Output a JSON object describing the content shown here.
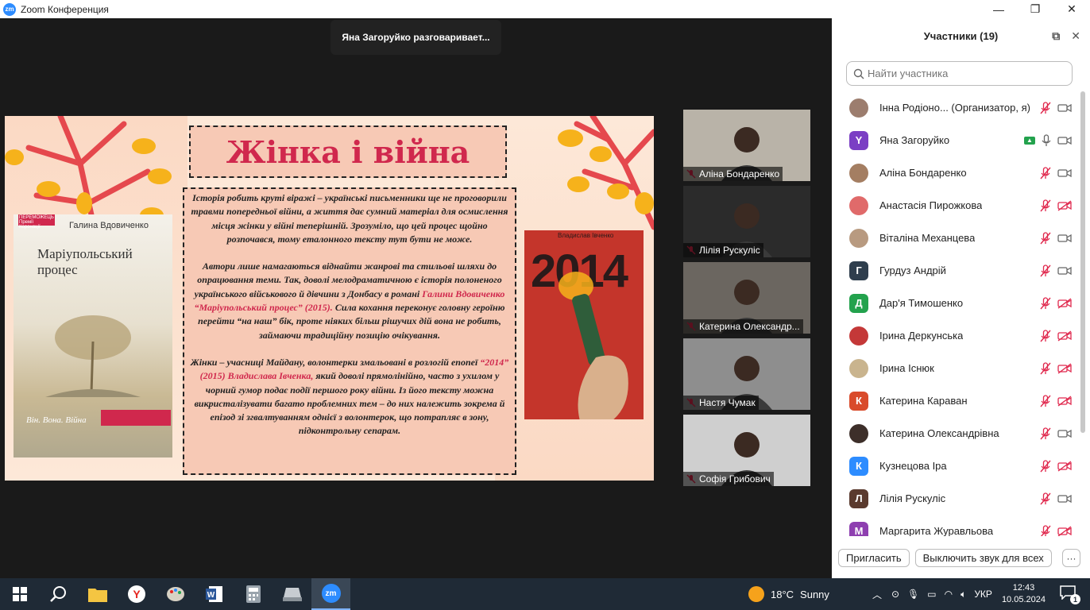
{
  "window": {
    "title": "Zoom Конференция"
  },
  "speaker_banner": "Яна Загоруйко разговариваeт...",
  "slide": {
    "title": "Жінка і війна",
    "para1": "Історія робить круті віражі – українські письменники ще не проговорили травми попередньої війни, а життя дає сумний матеріал для осмислення місця жінки у війні теперішній. Зрозуміло, що цей процес щойно розпочався, тому еталонного тексту тут бути не може.",
    "para2_a": "Автори лише намагаються віднайти жанрові та стильові шляхи до опрацювання теми. Так, доволі мелодраматичною є історія полоненого українського військового й дівчини з Донбасу в романі ",
    "para2_hl": "Галини Вдовиченко “Маріупольський процес” (2015).",
    "para2_b": " Сила кохання переконує головну героїню перейти “на наш” бік, проте ніяких більш рішучих дій вона не робить, займаючи традиційну позицію очікування.",
    "para3_a": "Жінки – учасниці Майдану, волонтерки змальовані в розлогій епопеї ",
    "para3_hl": "“2014” (2015) Владислава Івченка,",
    "para3_b": " який доволі прямолінійно, часто з ухилом у чорний гумор подає події першого року війни. Із його тексту можна викристалізувати багато проблемних тем – до них  належить зокрема й епізод зі згвалтуванням однієї з волонтерок, що потрапляє в зону, підконтрольну сепарам.",
    "book1": {
      "badge": "ПЕРЕМОЖЕЦЬ Премії Коронації",
      "author": "Галина Вдовиченко",
      "title_line1": "Маріупольський",
      "title_line2": "процес",
      "tagline": "Він. Вона. Війна"
    },
    "book2": {
      "author": "Владислав Івченко",
      "title": "2014"
    }
  },
  "video_tiles": [
    {
      "name": "Аліна Бондаренко",
      "bg": "#b9b3a8"
    },
    {
      "name": "Лілія Рускуліс",
      "bg": "#2b2b2b"
    },
    {
      "name": "Катерина Олександр...",
      "bg": "#6b6660"
    },
    {
      "name": "Настя Чумак",
      "bg": "#8e8e8e"
    },
    {
      "name": "Софія Грибович",
      "bg": "#cfcfcf"
    }
  ],
  "panel": {
    "title": "Участники (19)",
    "search_placeholder": "Найти участника",
    "participants": [
      {
        "name": "Інна Родіоно... (Организатор, я)",
        "avatar_letter": "",
        "avatar_color": "#9c7d6e",
        "video_off": false,
        "sharing": false
      },
      {
        "name": "Яна Загоруйко",
        "avatar_letter": "Y",
        "avatar_color": "#7b3fc4",
        "video_off": false,
        "sharing": true
      },
      {
        "name": "Аліна Бондаренко",
        "avatar_letter": "",
        "avatar_color": "#a47e62",
        "video_off": false,
        "sharing": false
      },
      {
        "name": "Анастасія Пирожкова",
        "avatar_letter": "",
        "avatar_color": "#e06a6a",
        "video_off": true,
        "sharing": false
      },
      {
        "name": "Віталіна Механцева",
        "avatar_letter": "",
        "avatar_color": "#b89a80",
        "video_off": false,
        "sharing": false
      },
      {
        "name": "Гурдуз Андрій",
        "avatar_letter": "Г",
        "avatar_color": "#2f3e4d",
        "video_off": false,
        "sharing": false
      },
      {
        "name": "Дар'я Тимошенко",
        "avatar_letter": "Д",
        "avatar_color": "#23a24d",
        "video_off": true,
        "sharing": false
      },
      {
        "name": "Ірина Деркунська",
        "avatar_letter": "",
        "avatar_color": "#c43838",
        "video_off": true,
        "sharing": false
      },
      {
        "name": "Ірина Існюк",
        "avatar_letter": "",
        "avatar_color": "#c9b48e",
        "video_off": true,
        "sharing": false
      },
      {
        "name": "Катерина Караван",
        "avatar_letter": "К",
        "avatar_color": "#d94b2b",
        "video_off": true,
        "sharing": false
      },
      {
        "name": "Катерина Олександрівна",
        "avatar_letter": "",
        "avatar_color": "#3d2f2a",
        "video_off": false,
        "sharing": false
      },
      {
        "name": "Кузнецова Іра",
        "avatar_letter": "К",
        "avatar_color": "#2d8cff",
        "video_off": true,
        "sharing": false
      },
      {
        "name": "Лілія Рускуліс",
        "avatar_letter": "Л",
        "avatar_color": "#5a3a2e",
        "video_off": false,
        "sharing": false
      },
      {
        "name": "Маргарита Журавльова",
        "avatar_letter": "М",
        "avatar_color": "#8e3fb0",
        "video_off": true,
        "sharing": false
      }
    ],
    "invite_label": "Пригласить",
    "mute_all_label": "Выключить звук для всех",
    "more_label": "···"
  },
  "taskbar": {
    "weather_temp": "18°C",
    "weather_text": "Sunny",
    "lang": "УКР",
    "time": "12:43",
    "date": "10.05.2024",
    "notif_count": "1"
  },
  "colors": {
    "accent": "#2d8cff",
    "muted_red": "#e0284d",
    "slide_red": "#d0284d"
  }
}
